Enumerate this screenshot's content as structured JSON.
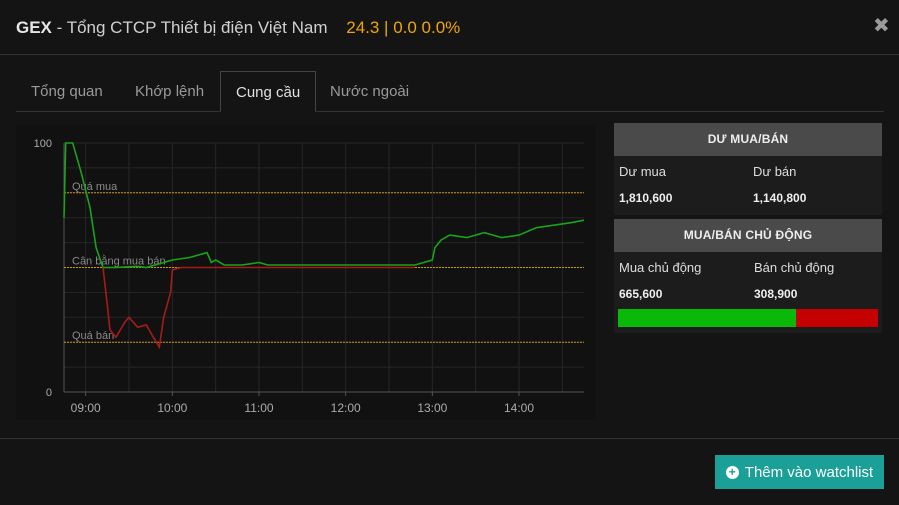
{
  "header": {
    "symbol": "GEX",
    "name": " - Tổng CTCP Thiết bị điện Việt Nam",
    "price_text": "24.3 | 0.0 0.0%"
  },
  "tabs": [
    {
      "label": "Tổng quan",
      "active": false
    },
    {
      "label": "Khớp lệnh",
      "active": false
    },
    {
      "label": "Cung cầu",
      "active": true
    },
    {
      "label": "Nước ngoài",
      "active": false
    }
  ],
  "chart_data": {
    "type": "line",
    "ylim": [
      0,
      100
    ],
    "y_ticks": [
      "100",
      "0"
    ],
    "x_ticks": [
      "09:00",
      "10:00",
      "11:00",
      "12:00",
      "13:00",
      "14:00"
    ],
    "x_range_hours": [
      8.75,
      14.75
    ],
    "thresholds": [
      {
        "label": "Quá mua",
        "value": 80
      },
      {
        "label": "Cân bằng mua bán",
        "value": 50
      },
      {
        "label": "Quá bán",
        "value": 20
      }
    ],
    "series": [
      {
        "color": "#1aa31a",
        "points": [
          [
            8.75,
            70
          ],
          [
            8.77,
            100
          ],
          [
            8.85,
            100
          ],
          [
            8.95,
            88
          ],
          [
            9.05,
            74
          ],
          [
            9.12,
            58
          ],
          [
            9.2,
            50
          ],
          [
            9.35,
            50
          ],
          [
            9.6,
            50.5
          ],
          [
            9.7,
            50
          ],
          [
            9.9,
            52
          ],
          [
            10.0,
            53
          ],
          [
            10.2,
            54
          ],
          [
            10.4,
            56
          ],
          [
            10.45,
            52
          ],
          [
            10.5,
            53
          ],
          [
            10.6,
            51
          ],
          [
            10.8,
            51
          ],
          [
            10.9,
            51.5
          ],
          [
            11.0,
            52
          ],
          [
            11.1,
            51
          ],
          [
            11.5,
            51
          ],
          [
            12.0,
            51
          ],
          [
            12.5,
            51
          ],
          [
            12.8,
            51
          ],
          [
            12.9,
            52
          ],
          [
            13.0,
            53
          ],
          [
            13.03,
            58
          ],
          [
            13.1,
            61
          ],
          [
            13.2,
            63
          ],
          [
            13.4,
            62
          ],
          [
            13.6,
            64
          ],
          [
            13.8,
            62
          ],
          [
            14.0,
            63
          ],
          [
            14.2,
            66
          ],
          [
            14.4,
            67
          ],
          [
            14.6,
            68
          ],
          [
            14.75,
            69
          ]
        ]
      },
      {
        "color": "#a81a1a",
        "points": [
          [
            9.2,
            50
          ],
          [
            9.25,
            35
          ],
          [
            9.28,
            25
          ],
          [
            9.35,
            22
          ],
          [
            9.45,
            28
          ],
          [
            9.5,
            30
          ],
          [
            9.6,
            26
          ],
          [
            9.7,
            27
          ],
          [
            9.78,
            22
          ],
          [
            9.85,
            18
          ],
          [
            9.9,
            30
          ],
          [
            9.98,
            40
          ],
          [
            10.0,
            49
          ],
          [
            10.1,
            50
          ],
          [
            10.5,
            50
          ],
          [
            10.8,
            50
          ],
          [
            11.0,
            50
          ],
          [
            12.0,
            50
          ],
          [
            12.5,
            50
          ],
          [
            12.8,
            50
          ]
        ]
      }
    ]
  },
  "panel_du": {
    "title": "DƯ MUA/BÁN",
    "buy_label": "Dư mua",
    "sell_label": "Dư bán",
    "buy_value": "1,810,600",
    "sell_value": "1,140,800"
  },
  "panel_cd": {
    "title": "MUA/BÁN CHỦ ĐỘNG",
    "buy_label": "Mua chủ động",
    "sell_label": "Bán chủ động",
    "buy_value": "665,600",
    "sell_value": "308,900",
    "buy_fraction": 0.683
  },
  "footer": {
    "add_label": "Thêm vào watchlist"
  },
  "colors": {
    "accent": "#f0a500",
    "button": "#1ba097",
    "buy": "#0ab80a",
    "sell": "#c40000",
    "threshold": "#c8941e"
  }
}
